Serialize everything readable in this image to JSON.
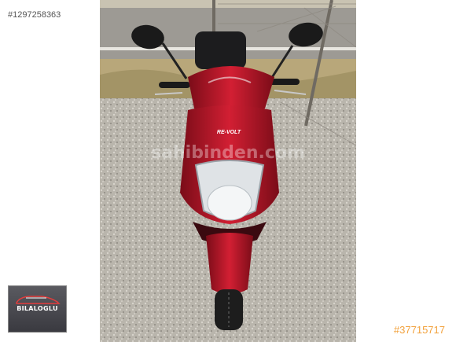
{
  "listing": {
    "image_id": "#1297258363",
    "ad_number": "#37715717",
    "watermark": "sahibinden.com"
  },
  "dealer": {
    "name": "BILALOGLU",
    "logo_bg": "#4a4a50"
  },
  "scooter": {
    "brand_text": "RE-VOLT",
    "color": "#c0182a"
  }
}
